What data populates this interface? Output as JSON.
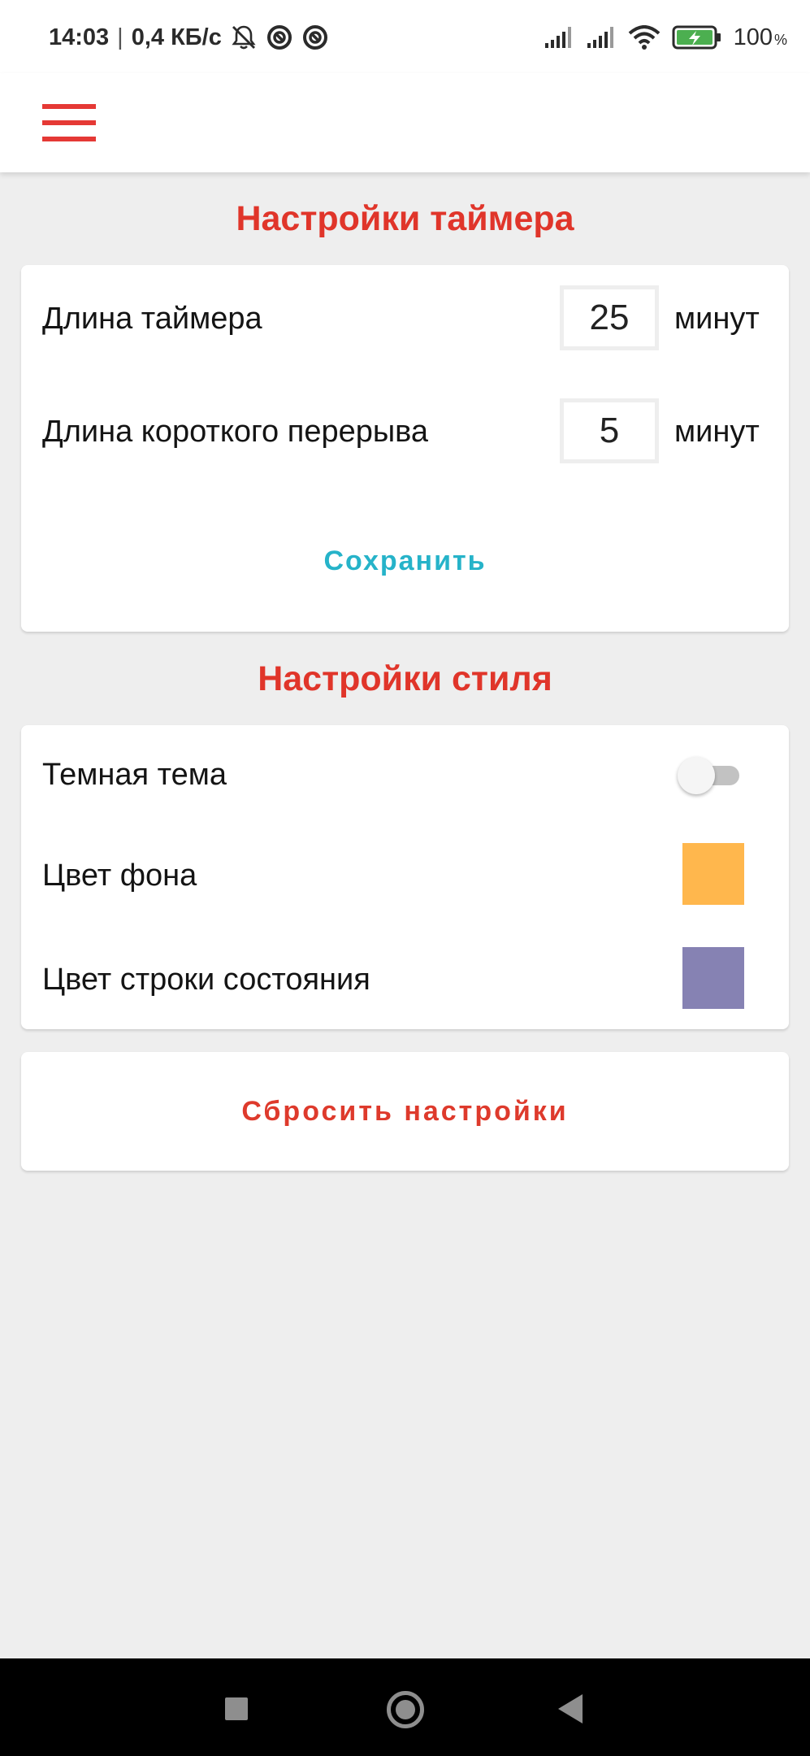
{
  "status_bar": {
    "time": "14:03",
    "separator": "|",
    "speed": "0,4 КБ/с",
    "battery_level": "100",
    "battery_unit": "%",
    "icons": [
      "notifications-off-icon",
      "sync-icon",
      "sync-icon",
      "signal-icon",
      "signal-icon",
      "wifi-icon",
      "battery-charging-icon"
    ]
  },
  "app_bar": {
    "menu_icon": "hamburger-menu-icon",
    "accent_color": "#e53935"
  },
  "timer_settings": {
    "title": "Настройки таймера",
    "timer_length": {
      "label": "Длина таймера",
      "value": "25",
      "unit": "минут"
    },
    "short_break": {
      "label": "Длина короткого перерыва",
      "value": "5",
      "unit": "минут"
    },
    "save_label": "Сохранить"
  },
  "style_settings": {
    "title": "Настройки стиля",
    "dark_theme": {
      "label": "Темная тема",
      "enabled": false
    },
    "background_color": {
      "label": "Цвет фона",
      "color": "#ffb74d"
    },
    "status_bar_color": {
      "label": "Цвет строки состояния",
      "color": "#8682b3"
    }
  },
  "reset_label": "Сбросить настройки",
  "nav_bar": {
    "icons": [
      "recents-square-icon",
      "home-circle-icon",
      "back-triangle-icon"
    ]
  }
}
